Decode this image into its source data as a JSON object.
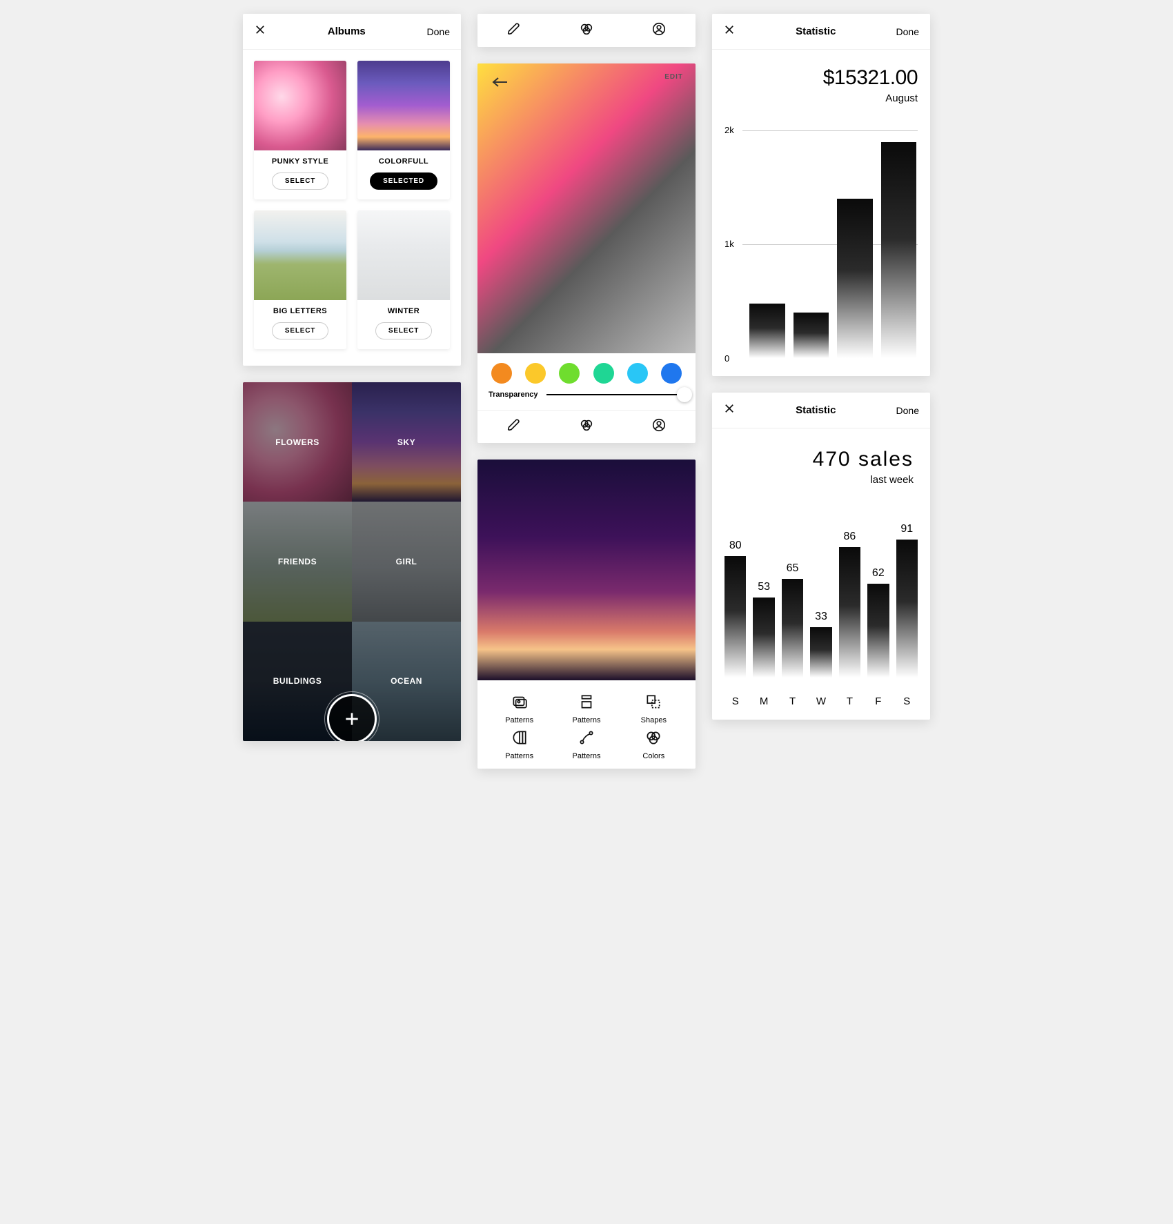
{
  "albums": {
    "title": "Albums",
    "done": "Done",
    "select_label": "SELECT",
    "selected_label": "SELECTED",
    "items": [
      {
        "name": "PUNKY STYLE",
        "selected": false,
        "thumb": "g-flowers"
      },
      {
        "name": "COLORFULL",
        "selected": true,
        "thumb": "g-sky"
      },
      {
        "name": "BIG LETTERS",
        "selected": false,
        "thumb": "g-field"
      },
      {
        "name": "WINTER",
        "selected": false,
        "thumb": "g-winter"
      }
    ]
  },
  "categories": {
    "items": [
      "FLOWERS",
      "SKY",
      "FRIENDS",
      "GIRL",
      "BUILDINGS",
      "OCEAN"
    ],
    "thumbs": [
      "g-flowers",
      "g-sky",
      "g-friends",
      "g-girl",
      "g-bld",
      "g-ocean"
    ]
  },
  "editor": {
    "edit_label": "EDIT",
    "transparency_label": "Transparency",
    "swatches": [
      "#f38a1f",
      "#fbc82a",
      "#6fdd2e",
      "#1fd694",
      "#29c6f6",
      "#1f77ee"
    ]
  },
  "tools": {
    "items": [
      "Patterns",
      "Patterns",
      "Shapes",
      "Patterns",
      "Patterns",
      "Colors"
    ]
  },
  "stat1": {
    "header": "Statistic",
    "done": "Done",
    "value": "$15321.00",
    "subtitle": "August",
    "y_ticks": [
      "2k",
      "1k"
    ],
    "zero": "0"
  },
  "stat2": {
    "header": "Statistic",
    "done": "Done",
    "value": "470 sales",
    "subtitle": "last week"
  },
  "chart_data": [
    {
      "type": "bar",
      "title": "$15321.00",
      "subtitle": "August",
      "categories": [
        "",
        "",
        "",
        ""
      ],
      "values": [
        480,
        400,
        1400,
        1900
      ],
      "ylim": [
        0,
        2000
      ],
      "yticks": [
        0,
        1000,
        2000
      ],
      "ylabel": "",
      "xlabel": ""
    },
    {
      "type": "bar",
      "title": "470 sales",
      "subtitle": "last week",
      "categories": [
        "S",
        "M",
        "T",
        "W",
        "T",
        "F",
        "S"
      ],
      "values": [
        80,
        53,
        65,
        33,
        86,
        62,
        91
      ],
      "ylim": [
        0,
        100
      ],
      "ylabel": "",
      "xlabel": ""
    }
  ]
}
